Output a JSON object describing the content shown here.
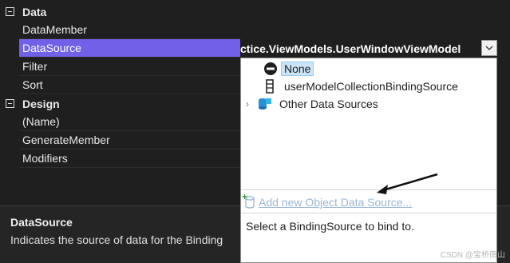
{
  "grid": {
    "categories": [
      {
        "label": "Data",
        "items": [
          "DataMember",
          "DataSource",
          "Filter",
          "Sort"
        ]
      },
      {
        "label": "Design",
        "items": [
          "(Name)",
          "GenerateMember",
          "Modifiers"
        ]
      }
    ],
    "selected_item": "DataSource"
  },
  "combo": {
    "value": "ctice.ViewModels.UserWindowViewModel"
  },
  "dropdown": {
    "items": [
      {
        "label": "None",
        "icon": "none-circle-icon",
        "selected": true
      },
      {
        "label": "userModelCollectionBindingSource",
        "icon": "binding-source-icon",
        "selected": false
      },
      {
        "label": "Other Data Sources",
        "icon": "data-sources-icon",
        "selected": false
      }
    ],
    "add_link": "Add new Object Data Source...",
    "description": "Select a BindingSource to bind to."
  },
  "description_pane": {
    "title": "DataSource",
    "text": "Indicates the source of data for the Binding"
  },
  "watermark": "CSDN @宝桥南山",
  "colors": {
    "selection": "#7160e8",
    "background": "#1f1f1f",
    "panel": "#ffffff",
    "link": "#9bb7d4"
  }
}
